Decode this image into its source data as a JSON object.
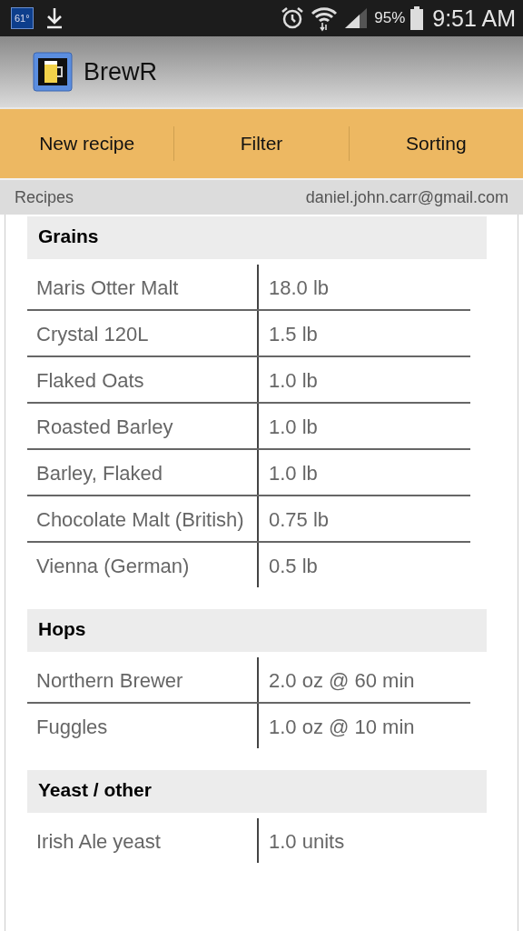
{
  "status_bar": {
    "weather": "61°",
    "battery": "95%",
    "time": "9:51 AM"
  },
  "app_bar": {
    "title": "BrewR"
  },
  "actions": [
    "New recipe",
    "Filter",
    "Sorting"
  ],
  "subheader": {
    "title": "Recipes",
    "account": "daniel.john.carr@gmail.com"
  },
  "sections": [
    {
      "title": "Grains",
      "rows": [
        {
          "name": "Maris Otter Malt",
          "amount": "18.0 lb"
        },
        {
          "name": "Crystal 120L",
          "amount": "1.5 lb"
        },
        {
          "name": "Flaked Oats",
          "amount": "1.0 lb"
        },
        {
          "name": "Roasted Barley",
          "amount": "1.0 lb"
        },
        {
          "name": "Barley, Flaked",
          "amount": "1.0 lb"
        },
        {
          "name": "Chocolate Malt (British)",
          "amount": "0.75 lb"
        },
        {
          "name": "Vienna (German)",
          "amount": "0.5 lb"
        }
      ]
    },
    {
      "title": "Hops",
      "rows": [
        {
          "name": "Northern Brewer",
          "amount": "2.0 oz @ 60 min"
        },
        {
          "name": "Fuggles",
          "amount": "1.0 oz @ 10 min"
        }
      ]
    },
    {
      "title": "Yeast / other",
      "rows": [
        {
          "name": "Irish Ale yeast",
          "amount": "1.0 units"
        }
      ]
    }
  ]
}
